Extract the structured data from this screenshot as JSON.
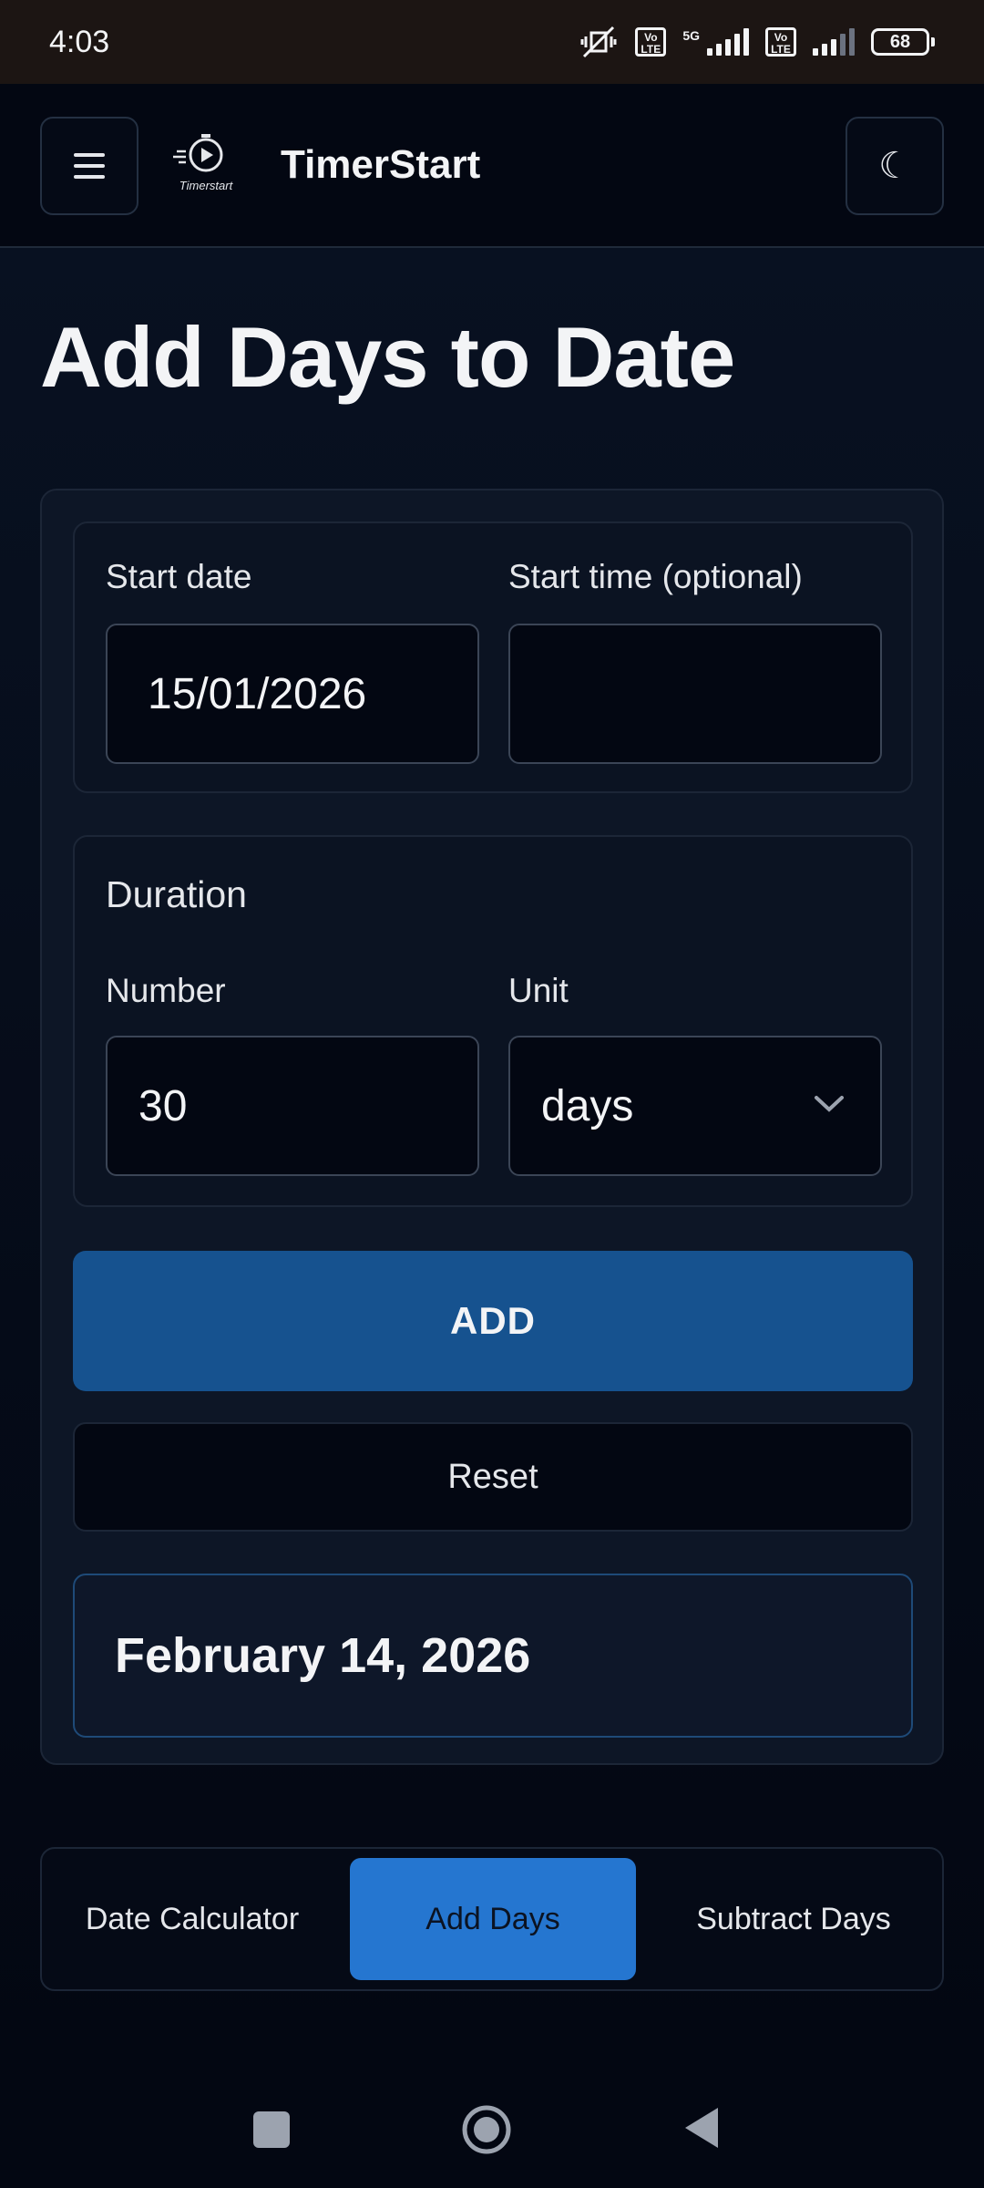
{
  "status_bar": {
    "time": "4:03",
    "network": "5G",
    "sim_tag": "Vo LTE",
    "battery": "68"
  },
  "app_bar": {
    "logo_text": "Timerstart",
    "title": "TimerStart",
    "menu_icon": "hamburger-menu-icon",
    "theme_icon": "moon-icon",
    "theme_glyph": "☾"
  },
  "page": {
    "title": "Add Days to Date"
  },
  "form": {
    "start_date_label": "Start date",
    "start_date_value": "15/01/2026",
    "start_time_label": "Start time (optional)",
    "start_time_value": "",
    "duration_title": "Duration",
    "number_label": "Number",
    "number_value": "30",
    "unit_label": "Unit",
    "unit_value": "days",
    "add_label": "ADD",
    "reset_label": "Reset"
  },
  "result": {
    "value": "February 14, 2026"
  },
  "tabs": [
    {
      "label": "Date Calculator",
      "active": false
    },
    {
      "label": "Add Days",
      "active": true
    },
    {
      "label": "Subtract Days",
      "active": false
    }
  ],
  "colors": {
    "accent": "#16528f",
    "active_tab": "#2576d0",
    "background": "#030712"
  }
}
